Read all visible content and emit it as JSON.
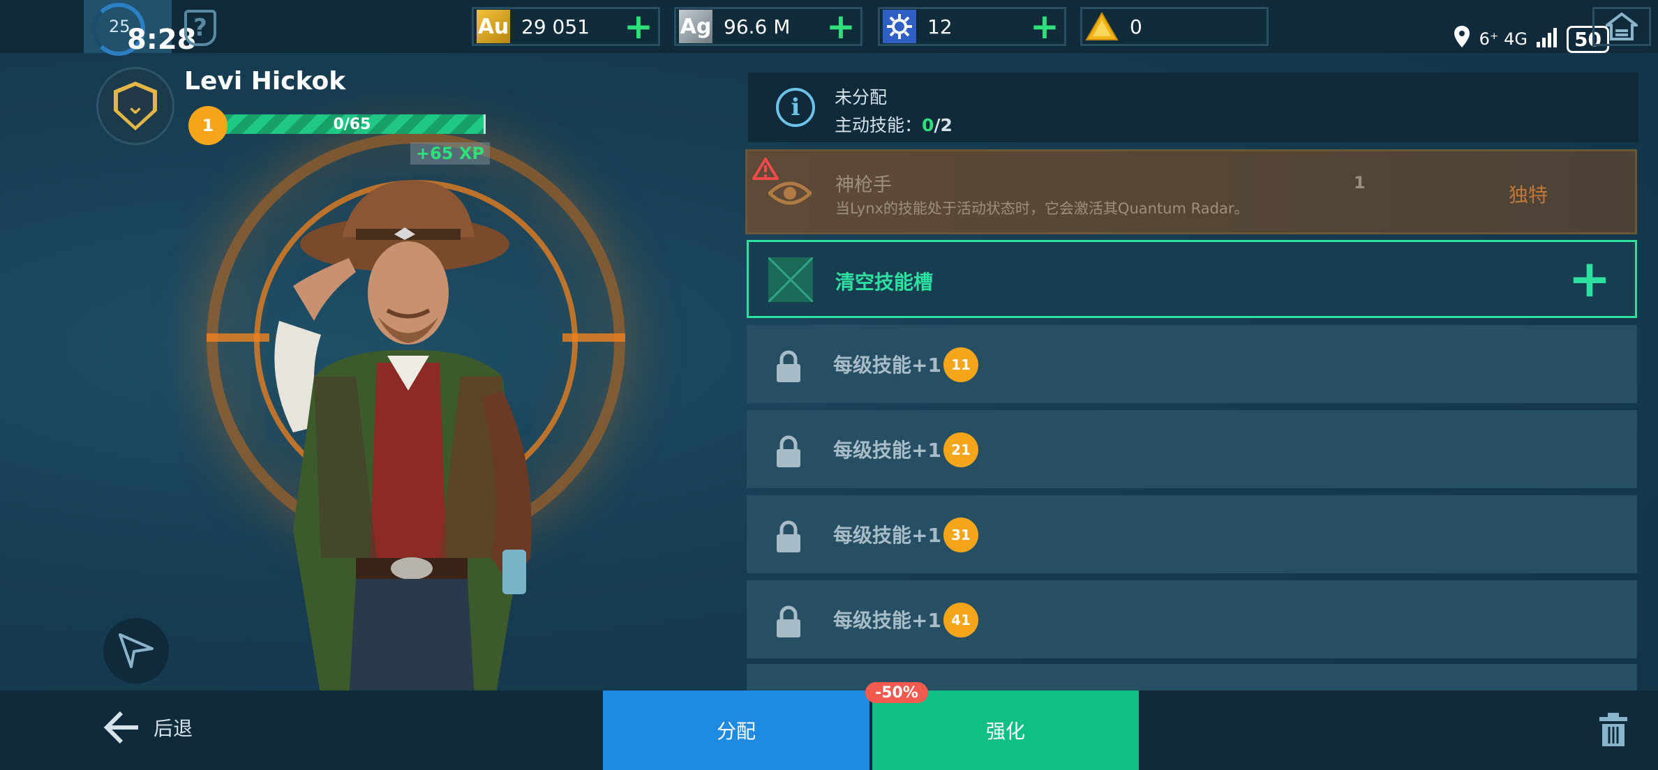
{
  "status_bar": {
    "rank": "25",
    "time": "8:28",
    "network": "6⁺ 4G",
    "battery": "50"
  },
  "currencies": [
    {
      "icon": "Au",
      "value": "29 051",
      "color": "#d9a520"
    },
    {
      "icon": "Ag",
      "value": "96.6 M",
      "color": "#9aa5ad"
    },
    {
      "icon": "gear-token-icon",
      "value": "12",
      "color": "#3b6fd6"
    },
    {
      "icon": "triangle-token-icon",
      "value": "0",
      "color": "#e8b21d"
    }
  ],
  "hero": {
    "name": "Levi Hickok",
    "level": "1",
    "xp": "0/65",
    "xp_bonus": "+65 XP"
  },
  "info": {
    "title": "未分配",
    "active_label": "主动技能：",
    "active_used": "0",
    "active_total": "/2"
  },
  "skill": {
    "name": "神枪手",
    "description": "当Lynx的技能处于活动状态时，它会激活其Quantum Radar。",
    "count": "1",
    "tag": "独特"
  },
  "empty_slot": {
    "label": "清空技能槽"
  },
  "locked_rows": [
    {
      "label": "每级技能+1",
      "level": "11"
    },
    {
      "label": "每级技能+1",
      "level": "21"
    },
    {
      "label": "每级技能+1",
      "level": "31"
    },
    {
      "label": "每级技能+1",
      "level": "41"
    }
  ],
  "bottom": {
    "back": "后退",
    "assign": "分配",
    "enhance": "强化",
    "discount": "-50%"
  },
  "colors": {
    "accent_green": "#2ee0a0",
    "assign_blue": "#1f8be0",
    "enhance_green": "#0fbf85",
    "level_orange": "#f5a51a"
  }
}
